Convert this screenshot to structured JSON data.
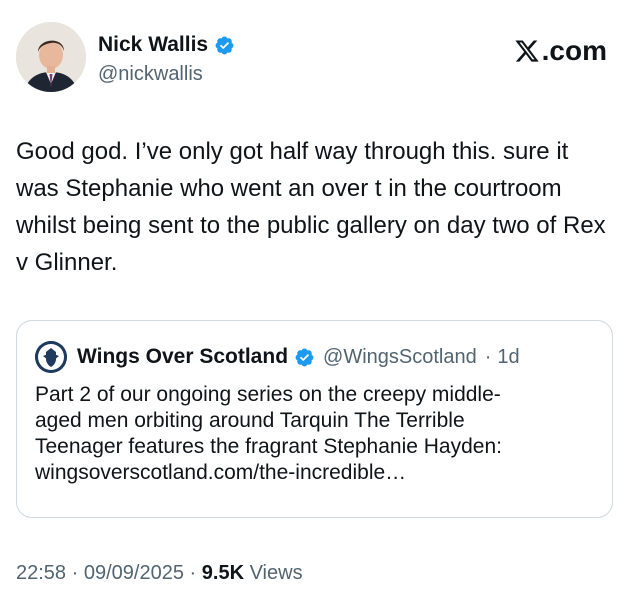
{
  "author": {
    "display_name": "Nick Wallis",
    "handle": "@nickwallis"
  },
  "brand": {
    "site_label": ".com",
    "icon": "x-logo-icon"
  },
  "tweet": {
    "text": "Good god. I’ve only got half way through this. sure it was Stephanie who went an over t in the courtroom whilst being sent to the public gallery on day two of Rex v Glinner."
  },
  "quote": {
    "display_name": "Wings Over Scotland",
    "handle": "@WingsScotland",
    "separator": "·",
    "age": "1d",
    "text_lines": [
      "Part 2 of our ongoing series on the creepy middle-",
      "aged men orbiting around Tarquin The Terrible",
      "Teenager features the fragrant Stephanie Hayden:",
      "wingsoverscotland.com/the-incredible…"
    ]
  },
  "meta": {
    "time": "22:58",
    "date": "09/09/2025",
    "separator": "·",
    "views_count": "9.5K",
    "views_label": "Views"
  },
  "colors": {
    "verified": "#1d9bf0",
    "secondary_text": "#536471",
    "border": "#cfd9de"
  }
}
